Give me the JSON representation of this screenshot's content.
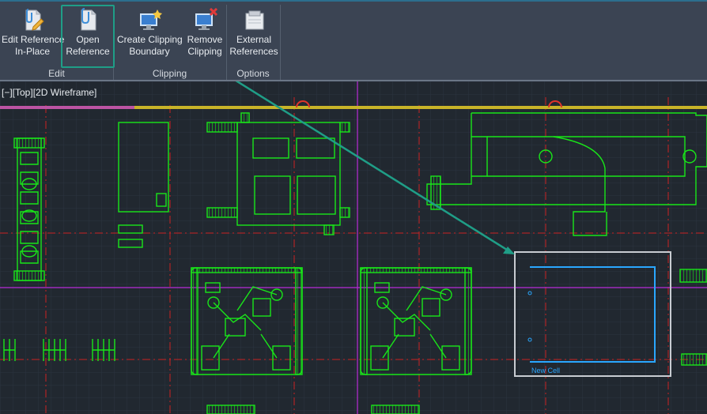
{
  "ribbon": {
    "tools": [
      {
        "line1": "Edit Reference",
        "line2": "In-Place"
      },
      {
        "line1": "Open",
        "line2": "Reference"
      },
      {
        "line1": "Create Clipping",
        "line2": "Boundary"
      },
      {
        "line1": "Remove",
        "line2": "Clipping"
      },
      {
        "line1": "External",
        "line2": "References"
      }
    ],
    "panels": [
      "Edit",
      "Clipping",
      "Options"
    ]
  },
  "viewport": {
    "label": "[−][Top][2D Wireframe]",
    "xref_label": "New Cell"
  },
  "colors": {
    "accent": "#1f9e87",
    "geometry": "#19e619",
    "grid_red": "#cc2222",
    "xref_blue": "#2aa7ff",
    "magenta": "#b82bd8"
  }
}
